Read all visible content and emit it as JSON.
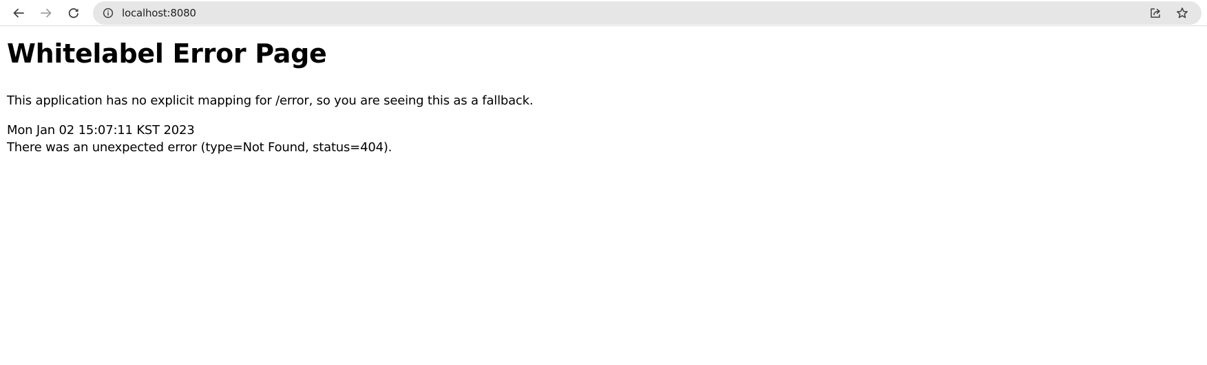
{
  "browser": {
    "icons": {
      "back": "arrow-left-icon",
      "forward": "arrow-right-icon",
      "reload": "reload-icon",
      "site_info": "info-circle-icon",
      "share": "share-icon",
      "bookmark": "star-icon"
    },
    "url": "localhost:8080",
    "colors": {
      "omnibox_bg": "#e6e6e6",
      "icon_active": "#3c4043",
      "icon_disabled": "#9aa0a6"
    }
  },
  "page": {
    "title": "Whitelabel Error Page",
    "message": "This application has no explicit mapping for /error, so you are seeing this as a fallback.",
    "timestamp": "Mon Jan 02 15:07:11 KST 2023",
    "error_detail": "There was an unexpected error (type=Not Found, status=404)."
  }
}
